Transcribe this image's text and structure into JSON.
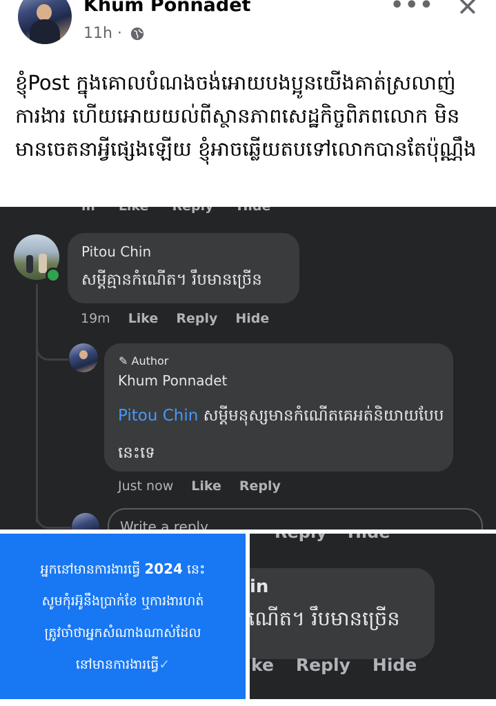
{
  "post": {
    "author": "Khum Ponnadet",
    "time": "11h ·",
    "more_label": "•••",
    "close_label": "✕",
    "text": "ខ្ញុំPost ក្នុងគោលបំណងចង់អោយបងប្អូនយើងគាត់ស្រលាញ់ការងារ ហើយអោយយល់ពីស្ថានភាពសេដ្ឋកិច្ចពិភពលោក មិនមានចេតនាអ្វីផ្សេងឡើយ ខ្ញុំអាចឆ្លើយតបទៅលោកបានតែប៉ុណ្ណឹង"
  },
  "screenshot1": {
    "cut_actions": [
      "m",
      "Like",
      "Reply",
      "Hide"
    ],
    "comment": {
      "name": "Pitou Chin",
      "text": "សម្តីគ្មានកំណើត។ រឹបមានច្រើន",
      "time": "19m",
      "like": "Like",
      "reply": "Reply",
      "hide": "Hide"
    },
    "reply": {
      "badge": "Author",
      "name": "Khum Ponnadet",
      "mention": "Pitou Chin",
      "text": " សម្តីមនុស្សមានកំណើតគេអត់និយាយបែបនេះទេ",
      "time": "Just now",
      "like": "Like",
      "reply": "Reply"
    },
    "input_placeholder": "Write a reply..."
  },
  "blue_card": {
    "line1_pre": "អ្នកនៅមានការងារធ្វើ ",
    "line1_year": "2024",
    "line1_post": " នេះ",
    "line2": "សូមកុំរអ៊ូនឹងប្រាក់ខែ ឬការងារហត់",
    "line3": "ត្រូវចាំថាអ្នកសំណាងណាស់ដែល",
    "line4": "នៅមានការងារធ្វើ",
    "check": "✓"
  },
  "screenshot2": {
    "cut_top": [
      "Reply",
      "Hide"
    ],
    "name": "in",
    "text": "ណើត។ រឹបមានច្រើន",
    "actions": [
      "ke",
      "Reply",
      "Hide"
    ]
  },
  "colors": {
    "dark_bg": "#242526",
    "bubble_bg": "#3a3b3c",
    "mention": "#4599ff",
    "card_blue": "#1877f2",
    "online": "#31a24c"
  }
}
